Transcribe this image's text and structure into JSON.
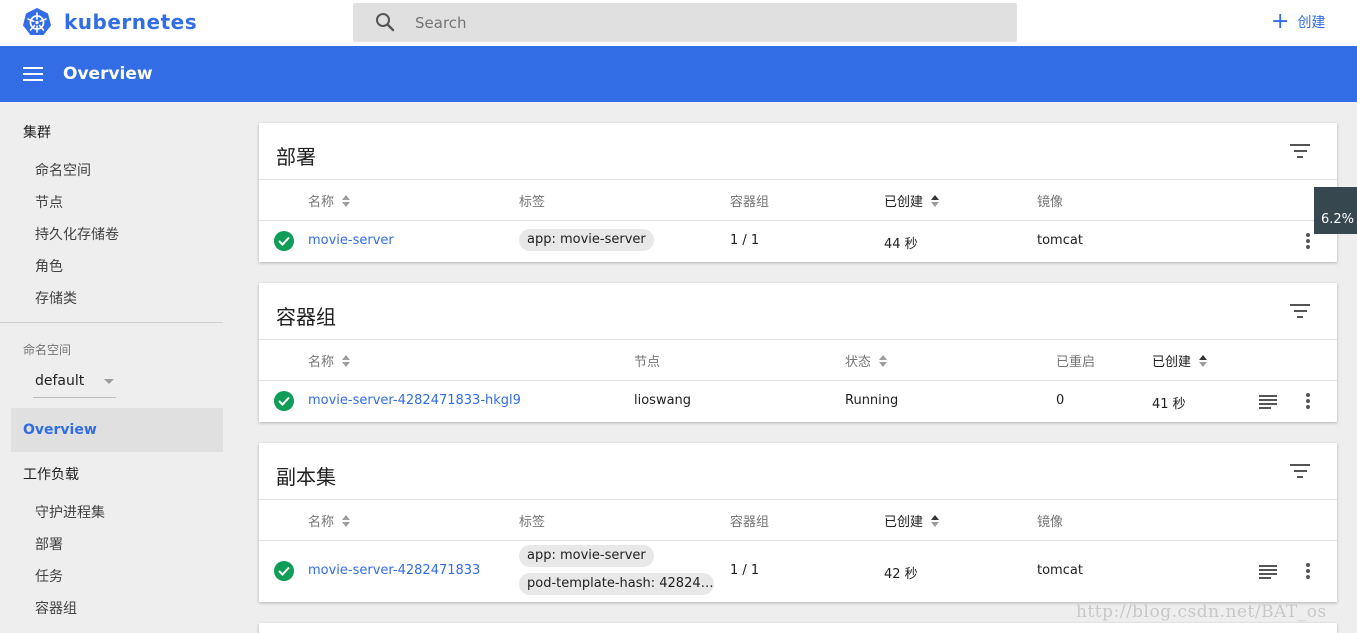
{
  "app": {
    "brand": "kubernetes"
  },
  "search": {
    "placeholder": "Search"
  },
  "actions": {
    "create_label": "创建"
  },
  "header": {
    "title": "Overview"
  },
  "sidebar": {
    "cluster_heading": "集群",
    "cluster_items": [
      "命名空间",
      "节点",
      "持久化存储卷",
      "角色",
      "存储类"
    ],
    "namespace_label": "命名空间",
    "namespace_value": "default",
    "active_item": "Overview",
    "workloads_heading": "工作负载",
    "workload_items": [
      "守护进程集",
      "部署",
      "任务",
      "容器组"
    ]
  },
  "deployments": {
    "title": "部署",
    "columns": [
      "名称",
      "标签",
      "容器组",
      "已创建",
      "镜像"
    ],
    "rows": [
      {
        "name": "movie-server",
        "labels": [
          "app: movie-server"
        ],
        "pods": "1 / 1",
        "created": "44 秒",
        "image": "tomcat"
      }
    ]
  },
  "pods": {
    "title": "容器组",
    "columns": [
      "名称",
      "节点",
      "状态",
      "已重启",
      "已创建"
    ],
    "rows": [
      {
        "name": "movie-server-4282471833-hkgl9",
        "node": "lioswang",
        "status": "Running",
        "restarts": "0",
        "created": "41 秒"
      }
    ]
  },
  "replicasets": {
    "title": "副本集",
    "columns": [
      "名称",
      "标签",
      "容器组",
      "已创建",
      "镜像"
    ],
    "rows": [
      {
        "name": "movie-server-4282471833",
        "labels": [
          "app: movie-server",
          "pod-template-hash: 42824…"
        ],
        "pods": "1 / 1",
        "created": "42 秒",
        "image": "tomcat"
      }
    ]
  },
  "tooltip": {
    "text": "6.2%"
  },
  "watermark": "http://blog.csdn.net/BAT_os",
  "colors": {
    "accent": "#326de6",
    "success": "#0f9d58"
  }
}
